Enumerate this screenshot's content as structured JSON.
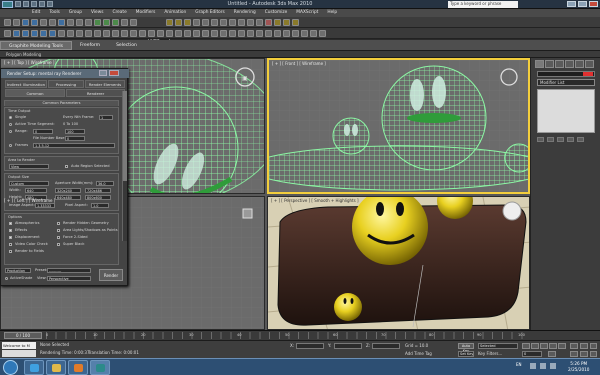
{
  "window": {
    "title": "Untitled - Autodesk 3ds Max 2010",
    "search_placeholder": "Type a keyword or phrase",
    "view_dropdown": "View"
  },
  "menu": [
    "Edit",
    "Tools",
    "Group",
    "Views",
    "Create",
    "Modifiers",
    "Animation",
    "Graph Editors",
    "Rendering",
    "Customize",
    "MAXScript",
    "Help"
  ],
  "ribbon": {
    "tabs": [
      "Graphite Modeling Tools",
      "Freeform",
      "Selection"
    ],
    "subtitle": "Polygon Modeling"
  },
  "viewports": {
    "top": {
      "label": "[ + ] [ Top ] [ Wireframe ]"
    },
    "front": {
      "label": "[ + ] [ Front ] [ Wireframe ]"
    },
    "left": {
      "label": "[ + ] [ Left ] [ Wireframe ]"
    },
    "perspective": {
      "label": "[ + ] [ Perspective ] [ Smooth + Highlights ]"
    }
  },
  "command_panel": {
    "modifier_list": "Modifier List",
    "accent_color": "#e03030"
  },
  "render_dialog": {
    "title": "Render Setup: mental ray Renderer",
    "tabs_row1": [
      "Indirect Illumination",
      "Processing",
      "Render Elements"
    ],
    "tabs_row2": [
      "Common",
      "Renderer"
    ],
    "rollout": "Common Parameters",
    "time_output": {
      "header": "Time Output",
      "single": "Single",
      "every_nth": "Every Nth Frame:",
      "every_nth_value": "1",
      "active": "Active Time Segment:",
      "active_range": "0 To 100",
      "range": "Range:",
      "range_from": "0",
      "range_to": "100",
      "file_number_base": "File Number Base:",
      "file_number_base_value": "0",
      "frames": "Frames",
      "frames_value": "1,3,5-12"
    },
    "area": {
      "header": "Area to Render",
      "value": "View",
      "auto_region": "Auto Region Selected"
    },
    "output_size": {
      "header": "Output Size",
      "preset": "Custom",
      "aperture_label": "Aperture Width(mm):",
      "aperture": "36.0",
      "width_label": "Width:",
      "width": "640",
      "height_label": "Height:",
      "height": "480",
      "presets": [
        "320x240",
        "720x486",
        "640x480",
        "800x600"
      ],
      "image_aspect_label": "Image Aspect:",
      "image_aspect": "1.33333",
      "pixel_aspect_label": "Pixel Aspect:",
      "pixel_aspect": "1.0"
    },
    "options": {
      "header": "Options",
      "items": [
        "Atmospherics",
        "Render Hidden Geometry",
        "Effects",
        "Area Lights/Shadows as Points",
        "Displacement",
        "Force 2-Sided",
        "Video Color Check",
        "Super Black",
        "Render to Fields"
      ]
    },
    "bottom": {
      "mode": "Production",
      "preset_label": "Preset:",
      "preset_value": "----------",
      "activeshade": "ActiveShade",
      "view_label": "View:",
      "view_value": "Perspective",
      "render_button": "Render"
    }
  },
  "timeline": {
    "slider": "0 / 100",
    "ticks": [
      "0",
      "10",
      "20",
      "30",
      "40",
      "50",
      "60",
      "70",
      "80",
      "90",
      "100"
    ]
  },
  "status": {
    "script_text": "Welcome to M",
    "selection": "None Selected",
    "rendering_time": "Rendering Time: 0:00:37",
    "translation_time": "Translation Time: 0:00:01",
    "x": "X:",
    "y": "Y:",
    "z": "Z:",
    "grid": "Grid = 10.0",
    "add_time_tag": "Add Time Tag",
    "auto_key": "Auto Key",
    "selected": "Selected",
    "set_key": "Set Key",
    "key_filters": "Key Filters...",
    "frame": "0"
  },
  "taskbar": {
    "lang": "EN",
    "time": "5:26 PM",
    "date": "2/25/2010"
  },
  "colors": {
    "wire_green": "#7df09a",
    "smiley_yellow": "#e8d020",
    "tray_brown": "#3a221a",
    "active_viewport": "#f3ce3c"
  }
}
